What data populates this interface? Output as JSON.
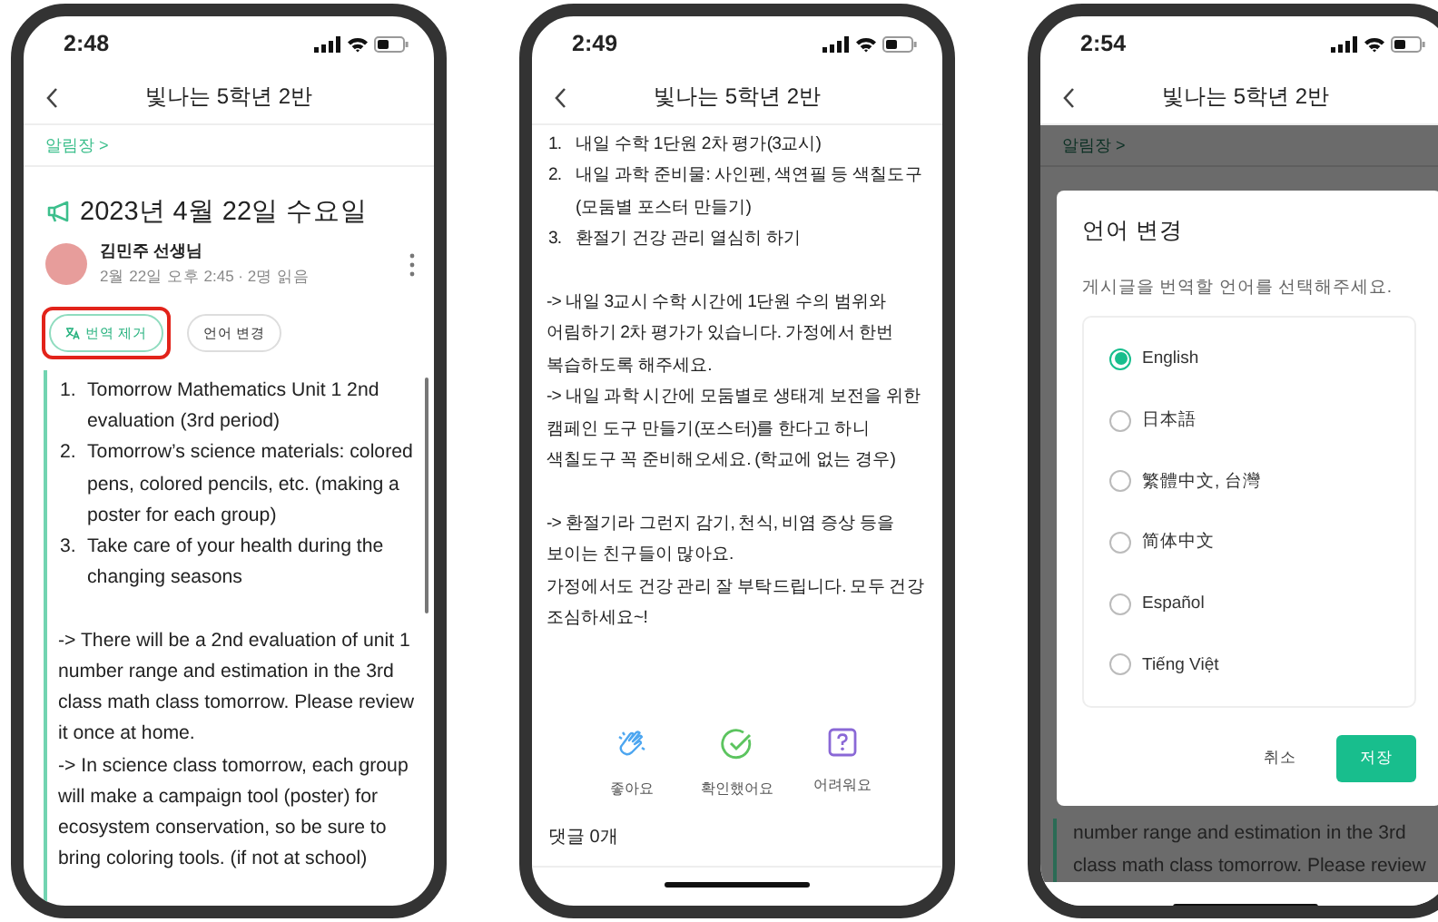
{
  "screens": [
    {
      "kind": "post",
      "status_bar": {
        "time": "2:48"
      },
      "header": {
        "title": "빛나는 5학년 2반"
      },
      "breadcrumb": "알림장 >",
      "post": {
        "title": "2023년 4월 22일 수요일",
        "author": "김민주 선생님",
        "meta": "2월 22일 오후 2:45 · 2명 읽음",
        "actions": [
          {
            "label": "번역 제거",
            "kind": "remove-translation",
            "highlighted": true
          },
          {
            "label": "언어 변경",
            "kind": "change-language",
            "highlighted": false
          }
        ],
        "list": [
          {
            "number": "1.",
            "text": "Tomorrow Mathematics Unit 1 2nd evaluation (3rd period)"
          },
          {
            "number": "2.",
            "text": "Tomorrow’s science materials: colored pens, colored pencils, etc. (making a poster for each group)"
          },
          {
            "number": "3.",
            "text": "Take care of your health during the changing seasons"
          }
        ],
        "blocks": [
          [
            "-> There will be a 2nd evaluation of unit 1 number range and estimation in the 3rd class math class tomorrow. Please review it once at home.",
            "-> In science class tomorrow, each group will make a campaign tool (poster) for ecosystem conservation, so be sure to bring coloring tools. (if not at school)"
          ]
        ]
      }
    },
    {
      "kind": "scrolled",
      "status_bar": {
        "time": "2:49"
      },
      "header": {
        "title": "빛나는 5학년 2반"
      },
      "post": {
        "list": [
          {
            "number": "1.",
            "text": "내일 수학 1단원 2차 평가(3교시)"
          },
          {
            "number": "2.",
            "text": "내일 과학 준비물: 사인펜, 색연필 등 색칠도구(모둠별 포스터 만들기)"
          },
          {
            "number": "3.",
            "text": "환절기 건강 관리 열심히 하기"
          }
        ],
        "blocks": [
          [
            "-> 내일 3교시 수학 시간에 1단원 수의 범위와 어림하기 2차 평가가 있습니다. 가정에서 한번 복습하도록 해주세요.",
            "-> 내일 과학 시간에 모둠별로 생태계 보전을 위한 캠페인 도구 만들기(포스터)를 한다고 하니 색칠도구 꼭 준비해오세요. (학교에 없는 경우)"
          ],
          [
            "-> 환절기라 그런지 감기, 천식, 비염 증상 등을 보이는 친구들이 많아요.",
            "가정에서도 건강 관리 잘 부탁드립니다. 모두 건강 조심하세요~!"
          ]
        ]
      },
      "reactions": [
        {
          "label": "좋아요",
          "kind": "clap"
        },
        {
          "label": "확인했어요",
          "kind": "check"
        },
        {
          "label": "어려워요",
          "kind": "question"
        }
      ],
      "comments": "댓글 0개"
    },
    {
      "kind": "dialog",
      "status_bar": {
        "time": "2:54"
      },
      "header": {
        "title": "빛나는 5학년 2반"
      },
      "breadcrumb": "알림장 >",
      "dialog": {
        "title": "언어 변경",
        "message": "게시글을 번역할 언어를 선택해주세요.",
        "options": [
          {
            "label": "English",
            "selected": true
          },
          {
            "label": "日本語",
            "selected": false
          },
          {
            "label": "繁體中文, 台灣",
            "selected": false
          },
          {
            "label": "简体中文",
            "selected": false
          },
          {
            "label": "Español",
            "selected": false
          },
          {
            "label": "Tiếng Việt",
            "selected": false
          }
        ],
        "cancel": "취소",
        "save": "저장"
      },
      "background_lines": [
        "number range and estimation in the 3rd",
        "class math class tomorrow. Please review"
      ]
    }
  ]
}
